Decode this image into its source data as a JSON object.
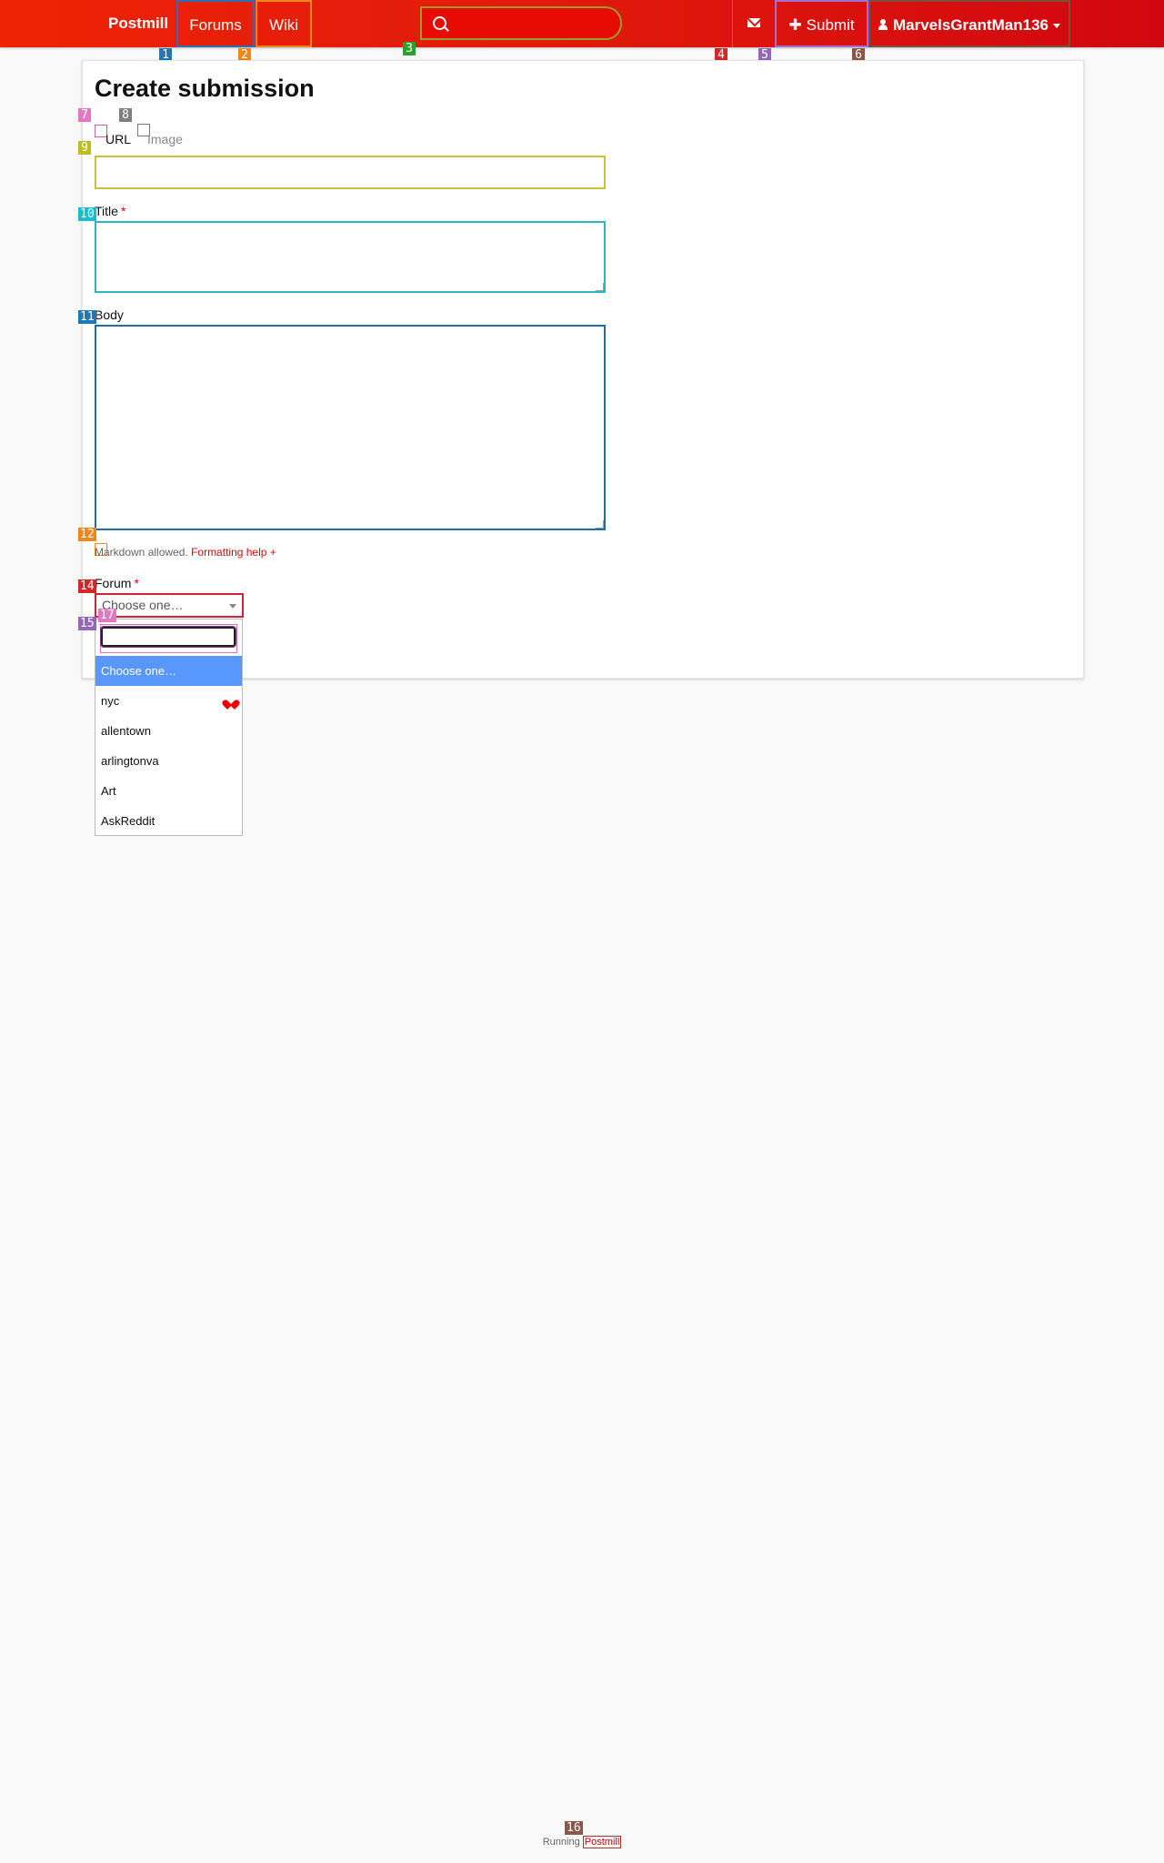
{
  "nav": {
    "brand": "Postmill",
    "forums": "Forums",
    "wiki": "Wiki",
    "search_placeholder": "",
    "submit": "Submit",
    "user": "MarvelsGrantMan136"
  },
  "form": {
    "heading": "Create submission",
    "radio_url": "URL",
    "radio_image": "Image",
    "title_label": "Title",
    "body_label": "Body",
    "required_mark": "*",
    "help_prefix": "Markdown allowed.",
    "help_link": "Formatting help +",
    "forum_label": "Forum",
    "forum_selected": "Choose one…"
  },
  "dropdown": {
    "options": [
      "Choose one…",
      "nyc",
      "allentown",
      "arlingtonva",
      "Art",
      "AskReddit"
    ]
  },
  "footer": {
    "prefix": "Running",
    "link": "Postmill"
  },
  "marks": [
    "1",
    "2",
    "3",
    "4",
    "5",
    "6",
    "7",
    "8",
    "9",
    "10",
    "11",
    "12",
    "14",
    "15",
    "16",
    "17"
  ],
  "colors": {
    "navbar": "#e30f0a",
    "accent_link": "#d40c0c",
    "dropdown_active": "#5897fb"
  }
}
